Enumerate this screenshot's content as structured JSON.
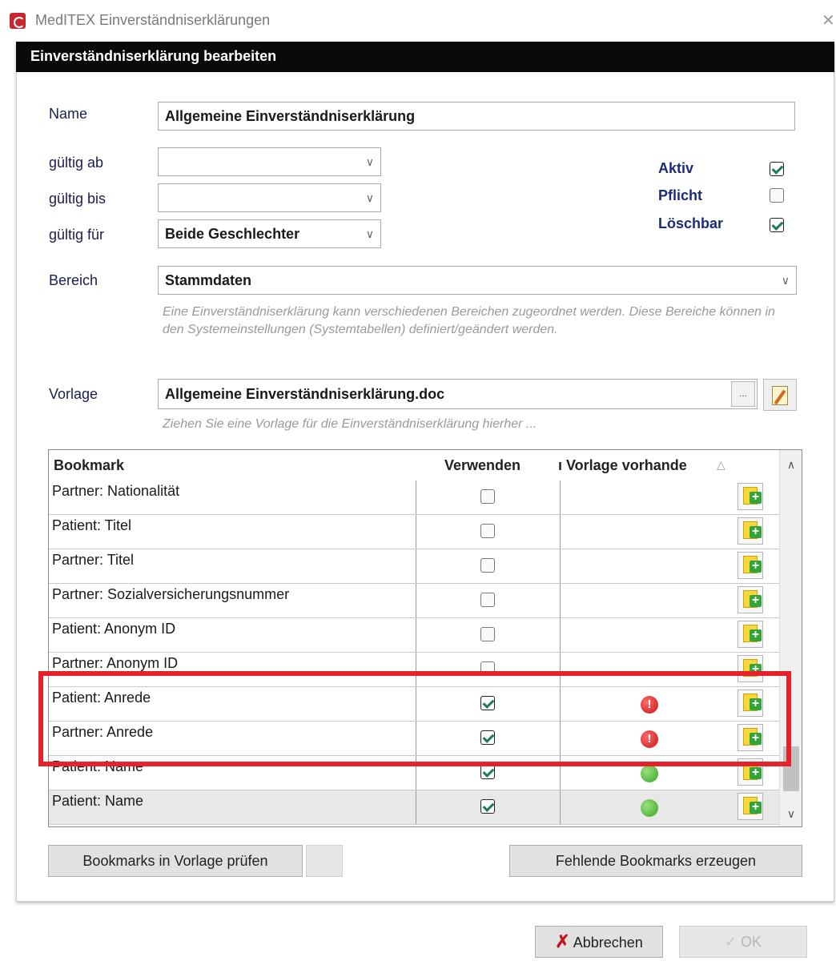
{
  "window": {
    "title": "MedITEX Einverständniserklärungen",
    "close_glyph": "✕"
  },
  "dialog": {
    "title": "Einverständniserklärung bearbeiten"
  },
  "form": {
    "name_label": "Name",
    "name_value": "Allgemeine Einverständniserklärung",
    "valid_from_label": "gültig ab",
    "valid_from_value": "",
    "valid_to_label": "gültig bis",
    "valid_to_value": "",
    "valid_for_label": "gültig für",
    "valid_for_value": "Beide Geschlechter",
    "area_label": "Bereich",
    "area_value": "Stammdaten",
    "area_hint": "Eine Einverständniserklärung kann verschiedenen Bereichen zugeordnet werden. Diese Bereiche können in den Systemeinstellungen (Systemtabellen) definiert/geändert werden.",
    "template_label": "Vorlage",
    "template_value": "Allgemeine Einverständniserklärung.doc",
    "template_browse": "...",
    "template_hint": "Ziehen Sie eine Vorlage für die Einverständniserklärung hierher ..."
  },
  "flags": [
    {
      "label": "Aktiv",
      "checked": true
    },
    {
      "label": "Pflicht",
      "checked": false
    },
    {
      "label": "Löschbar",
      "checked": true
    }
  ],
  "grid": {
    "columns": [
      "Bookmark",
      "Verwenden",
      "ı Vorlage vorhande"
    ],
    "sort_glyph": "△",
    "rows": [
      {
        "bookmark": "Partner: Nationalität",
        "use": false,
        "status": ""
      },
      {
        "bookmark": "Patient: Titel",
        "use": false,
        "status": ""
      },
      {
        "bookmark": "Partner: Titel",
        "use": false,
        "status": ""
      },
      {
        "bookmark": "Partner: Sozialversicherungsnummer",
        "use": false,
        "status": ""
      },
      {
        "bookmark": "Patient: Anonym ID",
        "use": false,
        "status": ""
      },
      {
        "bookmark": "Partner: Anonym ID",
        "use": false,
        "status": ""
      },
      {
        "bookmark": "Patient: Anrede",
        "use": true,
        "status": "missing"
      },
      {
        "bookmark": "Partner: Anrede",
        "use": true,
        "status": "missing"
      },
      {
        "bookmark": "Patient: Name",
        "use": true,
        "status": "ok"
      },
      {
        "bookmark": "Patient: Name",
        "use": true,
        "status": "ok"
      }
    ],
    "status_glyphs": {
      "missing": "!",
      "ok": ""
    }
  },
  "buttons": {
    "check_bookmarks": "Bookmarks in Vorlage prüfen",
    "create_missing": "Fehlende Bookmarks erzeugen",
    "cancel": "Abbrechen",
    "cancel_glyph": "✗",
    "ok": "OK",
    "ok_glyph": "✓"
  },
  "colors": {
    "highlight": "#e8202a",
    "header_bg": "#0a0a0a",
    "label": "#1c1c50",
    "flag_label": "#1c2a7a"
  }
}
